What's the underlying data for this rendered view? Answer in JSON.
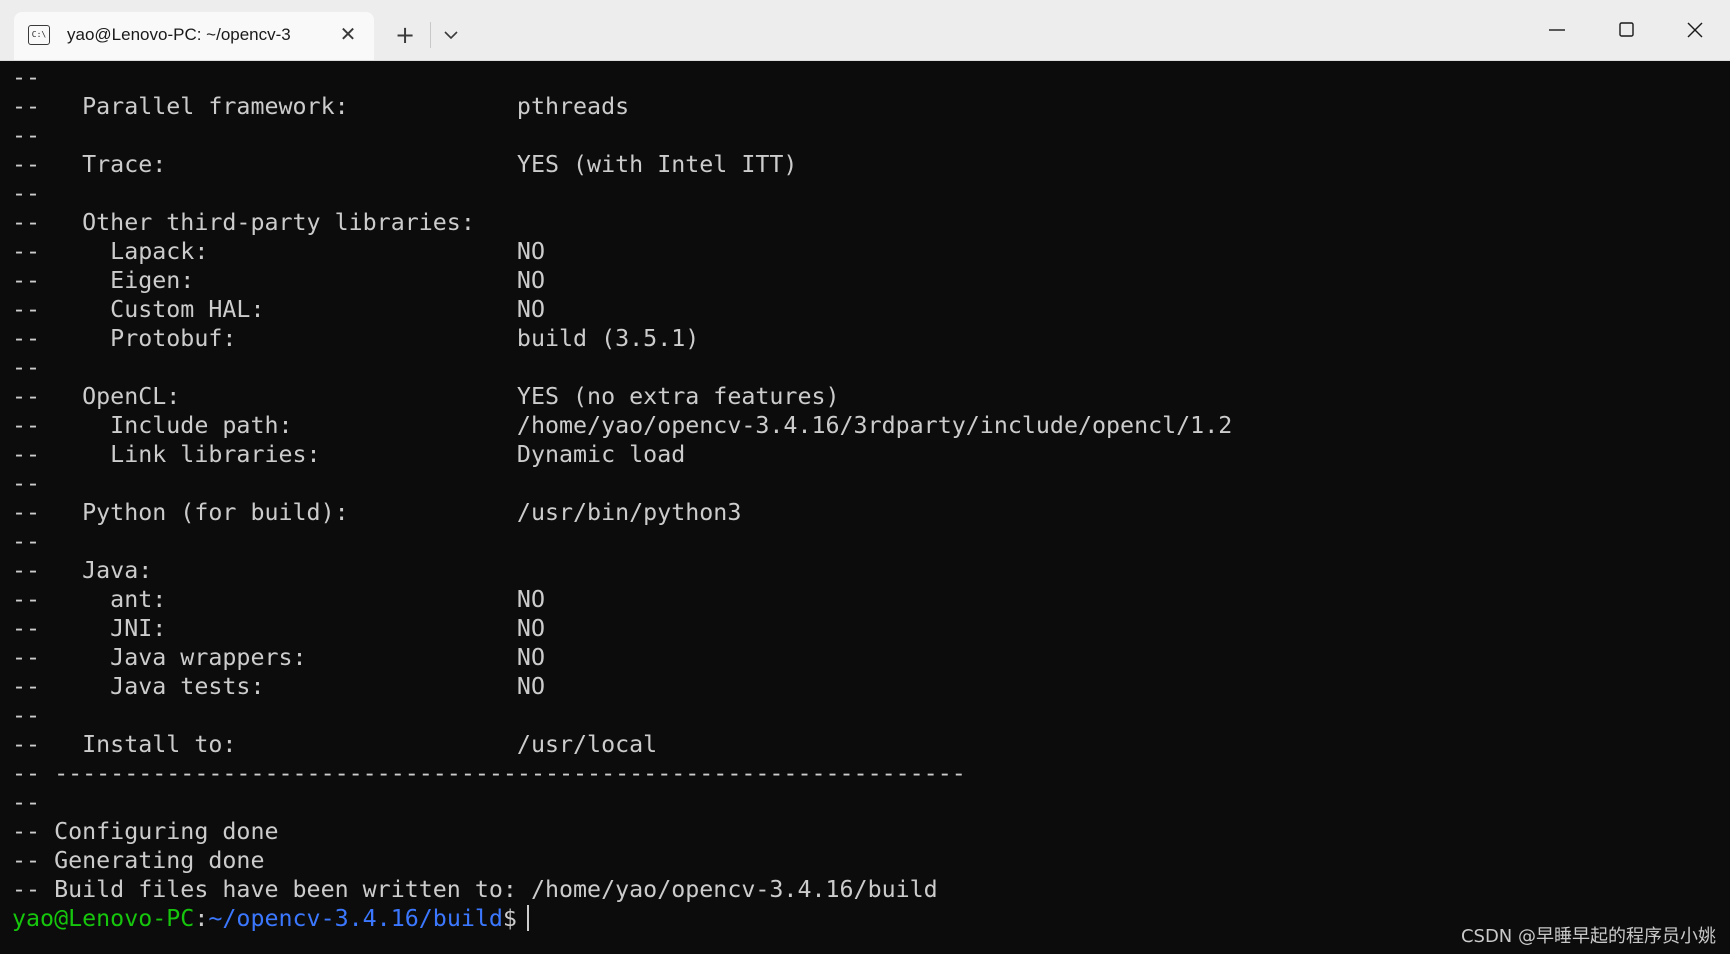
{
  "window": {
    "tab_title": "yao@Lenovo-PC: ~/opencv-3",
    "tab_icon_glyph": "C:\\",
    "close_tab_glyph": "✕",
    "new_tab_glyph": "+"
  },
  "colors": {
    "background": "#0c0c0c",
    "foreground": "#cccccc",
    "prompt_user": "#16c60c",
    "prompt_path": "#3b78ff",
    "titlebar": "#ededed"
  },
  "terminal": {
    "lines": [
      "--",
      "--   Parallel framework:            pthreads",
      "--",
      "--   Trace:                         YES (with Intel ITT)",
      "--",
      "--   Other third-party libraries:",
      "--     Lapack:                      NO",
      "--     Eigen:                       NO",
      "--     Custom HAL:                  NO",
      "--     Protobuf:                    build (3.5.1)",
      "--",
      "--   OpenCL:                        YES (no extra features)",
      "--     Include path:                /home/yao/opencv-3.4.16/3rdparty/include/opencl/1.2",
      "--     Link libraries:              Dynamic load",
      "--",
      "--   Python (for build):            /usr/bin/python3",
      "--",
      "--   Java:",
      "--     ant:                         NO",
      "--     JNI:                         NO",
      "--     Java wrappers:               NO",
      "--     Java tests:                  NO",
      "--",
      "--   Install to:                    /usr/local",
      "-- -----------------------------------------------------------------",
      "--",
      "-- Configuring done",
      "-- Generating done",
      "-- Build files have been written to: /home/yao/opencv-3.4.16/build"
    ],
    "prompt": {
      "user_host": "yao@Lenovo-PC",
      "separator": ":",
      "path": "~/opencv-3.4.16/build",
      "symbol": "$"
    }
  },
  "watermark": "CSDN @早睡早起的程序员小姚"
}
